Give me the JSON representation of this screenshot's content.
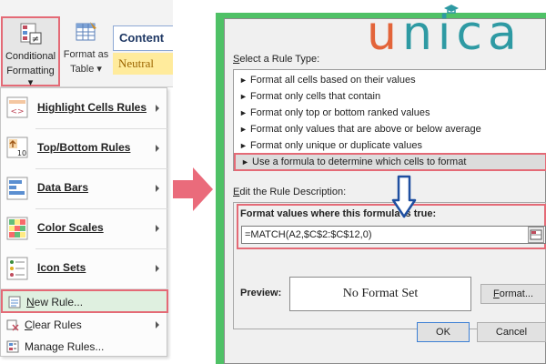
{
  "ribbon": {
    "conditional_formatting_line1": "Conditional",
    "conditional_formatting_line2": "Formatting ▾",
    "format_as_table_line1": "Format as",
    "format_as_table_line2": "Table ▾",
    "style_content": "Content",
    "style_neutral": "Neutral"
  },
  "menu": {
    "items": [
      {
        "label": "Highlight Cells Rules",
        "icon": "highlight-cells-icon",
        "submenu": true
      },
      {
        "label": "Top/Bottom Rules",
        "icon": "top-bottom-icon",
        "submenu": true
      },
      {
        "label": "Data Bars",
        "icon": "data-bars-icon",
        "submenu": true
      },
      {
        "label": "Color Scales",
        "icon": "color-scales-icon",
        "submenu": true
      },
      {
        "label": "Icon Sets",
        "icon": "icon-sets-icon",
        "submenu": true
      },
      {
        "label": "New Rule...",
        "icon": "new-rule-icon",
        "submenu": false
      },
      {
        "label": "Clear Rules",
        "icon": "clear-rules-icon",
        "submenu": true
      },
      {
        "label": "Manage Rules...",
        "icon": "manage-rules-icon",
        "submenu": false
      }
    ]
  },
  "dialog": {
    "select_rule_type_label": "Select a Rule Type:",
    "rule_types": [
      "Format all cells based on their values",
      "Format only cells that contain",
      "Format only top or bottom ranked values",
      "Format only values that are above or below average",
      "Format only unique or duplicate values",
      "Use a formula to determine which cells to format"
    ],
    "selected_rule_index": 5,
    "edit_rule_description_label": "Edit the Rule Description:",
    "format_values_label": "Format values where this formula is true:",
    "formula_value": "=MATCH(A2,$C$2:$C$12,0)",
    "preview_label": "Preview:",
    "preview_text": "No Format Set",
    "format_button": "Format...",
    "ok_button": "OK",
    "cancel_button": "Cancel"
  },
  "logo": {
    "first_letter": "u",
    "rest": "nica"
  },
  "colors": {
    "highlight_border": "#e46a76",
    "dialog_frame": "#4fc166",
    "logo_orange": "#e3643a",
    "logo_teal": "#2e9aa3",
    "arrow_pink": "#ea6b7b",
    "down_arrow_blue": "#1f4fa0"
  }
}
